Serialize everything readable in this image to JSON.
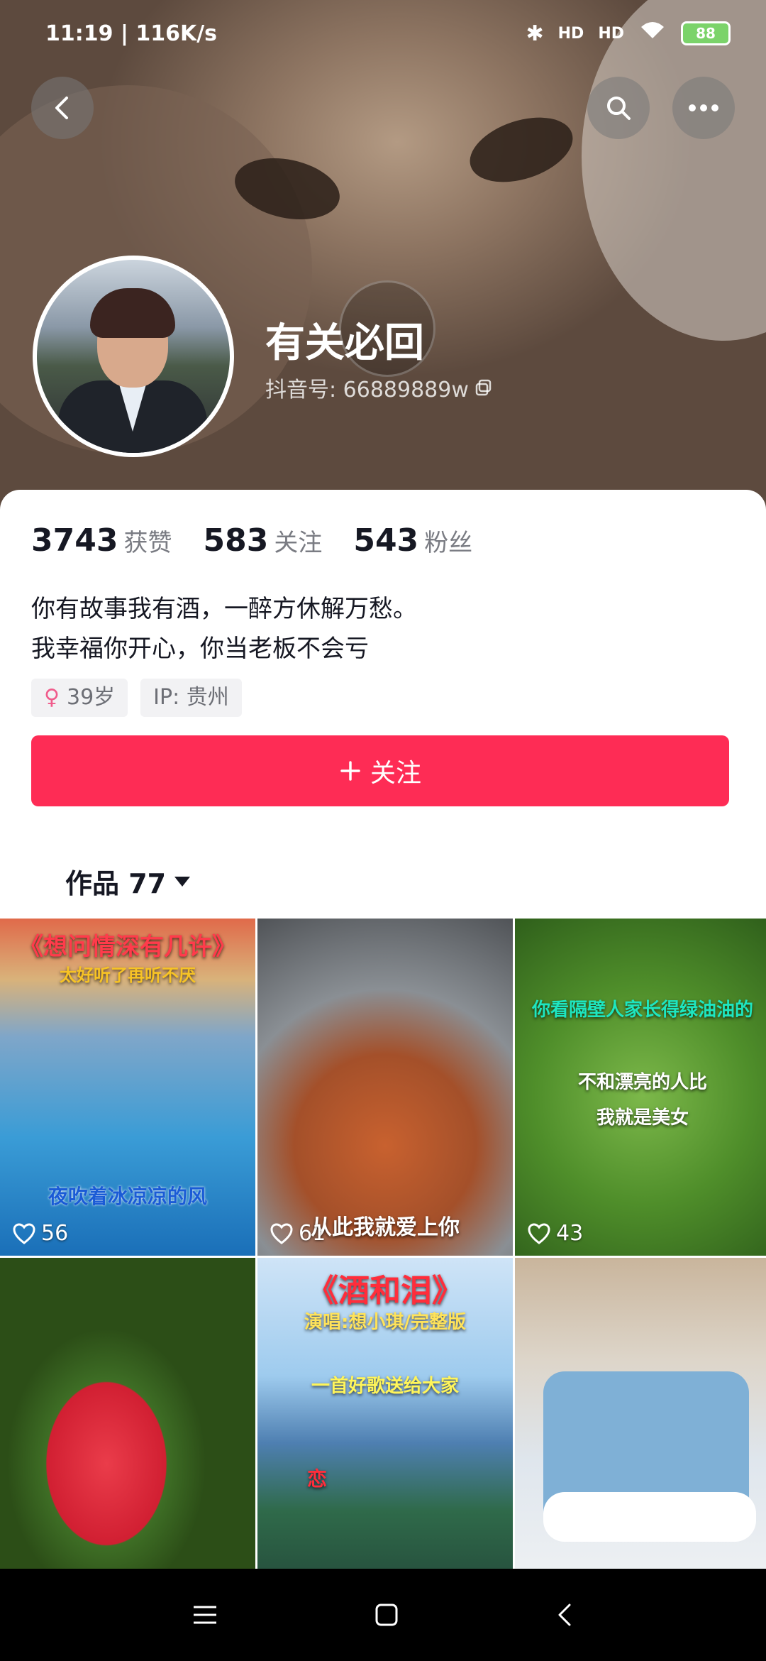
{
  "status_bar": {
    "time_speed": "11:19 | 116K/s",
    "battery": "88",
    "net_label_1": "HD",
    "net_label_2": "HD"
  },
  "profile": {
    "name": "有关必回",
    "douyin_id": "抖音号: 66889889w",
    "stats": [
      {
        "value": "3743",
        "label": "获赞"
      },
      {
        "value": "583",
        "label": "关注"
      },
      {
        "value": "543",
        "label": "粉丝"
      }
    ],
    "bio_line1": "你有故事我有酒，一醉方休解万愁。",
    "bio_line2": "我幸福你开心，你当老板不会亏",
    "age_tag": "39岁",
    "ip_tag": "IP: 贵州",
    "follow_label": "关注",
    "works_label": "作品 77"
  },
  "videos": [
    {
      "likes": "56",
      "title": "《想问情深有几许》",
      "subtitle": "太好听了再听不厌",
      "caption": "夜吹着冰凉凉的风"
    },
    {
      "likes": "61",
      "caption": "从此我就爱上你"
    },
    {
      "likes": "43",
      "title": "你看隔壁人家长得绿油油的",
      "line1": "不和漂亮的人比",
      "line2": "我就是美女"
    },
    {
      "likes": "",
      "caption": ""
    },
    {
      "likes": "",
      "title": "《酒和泪》",
      "subtitle": "演唱:想小琪/完整版",
      "line1": "一首好歌送给大家",
      "tag": "恋"
    },
    {
      "likes": "",
      "caption": ""
    }
  ],
  "colors": {
    "accent": "#fe2c55",
    "text_primary": "#161823",
    "text_secondary": "#7a7c83"
  }
}
